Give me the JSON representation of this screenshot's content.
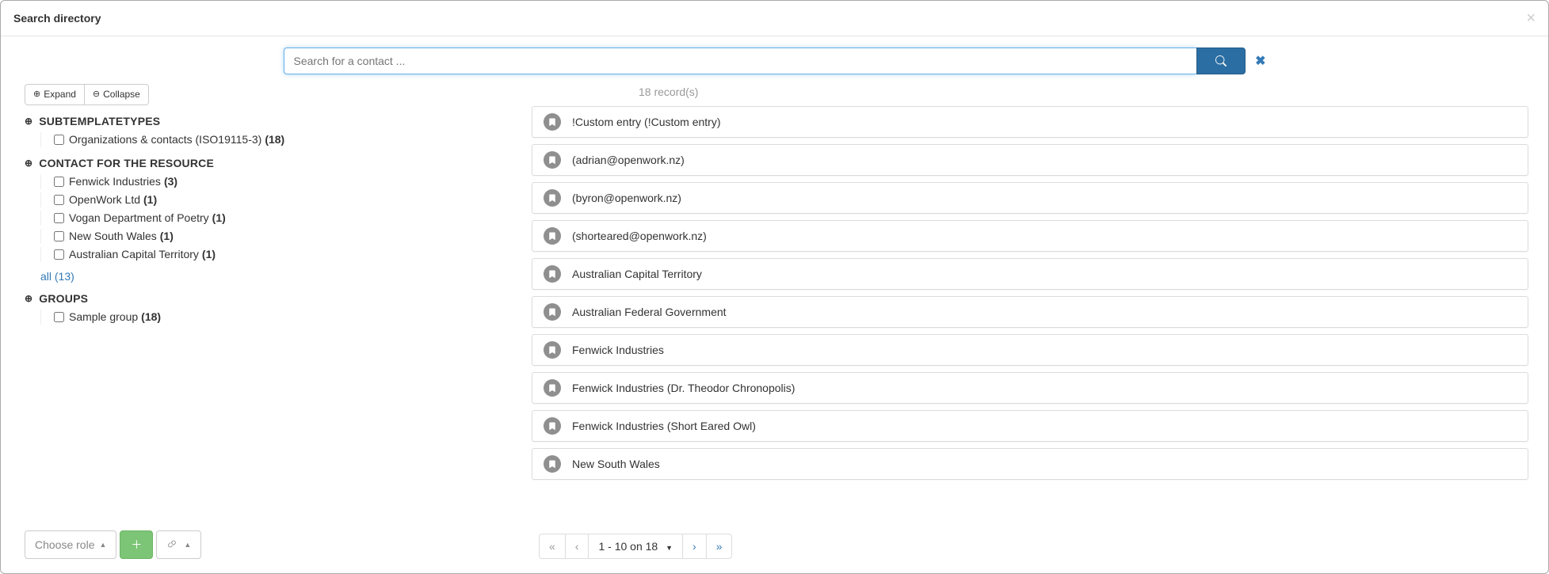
{
  "header": {
    "title": "Search directory"
  },
  "search": {
    "placeholder": "Search for a contact ..."
  },
  "sidebar": {
    "expand": "Expand",
    "collapse": "Collapse",
    "facets": [
      {
        "title": "SUBTEMPLATETYPES",
        "items": [
          {
            "label": "Organizations & contacts (ISO19115-3)",
            "count": "(18)"
          }
        ]
      },
      {
        "title": "CONTACT FOR THE RESOURCE",
        "items": [
          {
            "label": "Fenwick Industries",
            "count": "(3)"
          },
          {
            "label": "OpenWork Ltd",
            "count": "(1)"
          },
          {
            "label": "Vogan Department of Poetry",
            "count": "(1)"
          },
          {
            "label": "New South Wales",
            "count": "(1)"
          },
          {
            "label": "Australian Capital Territory",
            "count": "(1)"
          }
        ],
        "all": "all (13)"
      },
      {
        "title": "GROUPS",
        "items": [
          {
            "label": "Sample group",
            "count": "(18)"
          }
        ]
      }
    ]
  },
  "results": {
    "count_text": "18 record(s)",
    "items": [
      "!Custom entry (!Custom entry)",
      "(adrian@openwork.nz)",
      "(byron@openwork.nz)",
      "(shorteared@openwork.nz)",
      "Australian Capital Territory",
      "Australian Federal Government",
      "Fenwick Industries",
      "Fenwick Industries (Dr. Theodor Chronopolis)",
      "Fenwick Industries (Short Eared Owl)",
      "New South Wales"
    ]
  },
  "footer": {
    "choose_role": "Choose role",
    "pager_label": "1 - 10 on 18"
  }
}
